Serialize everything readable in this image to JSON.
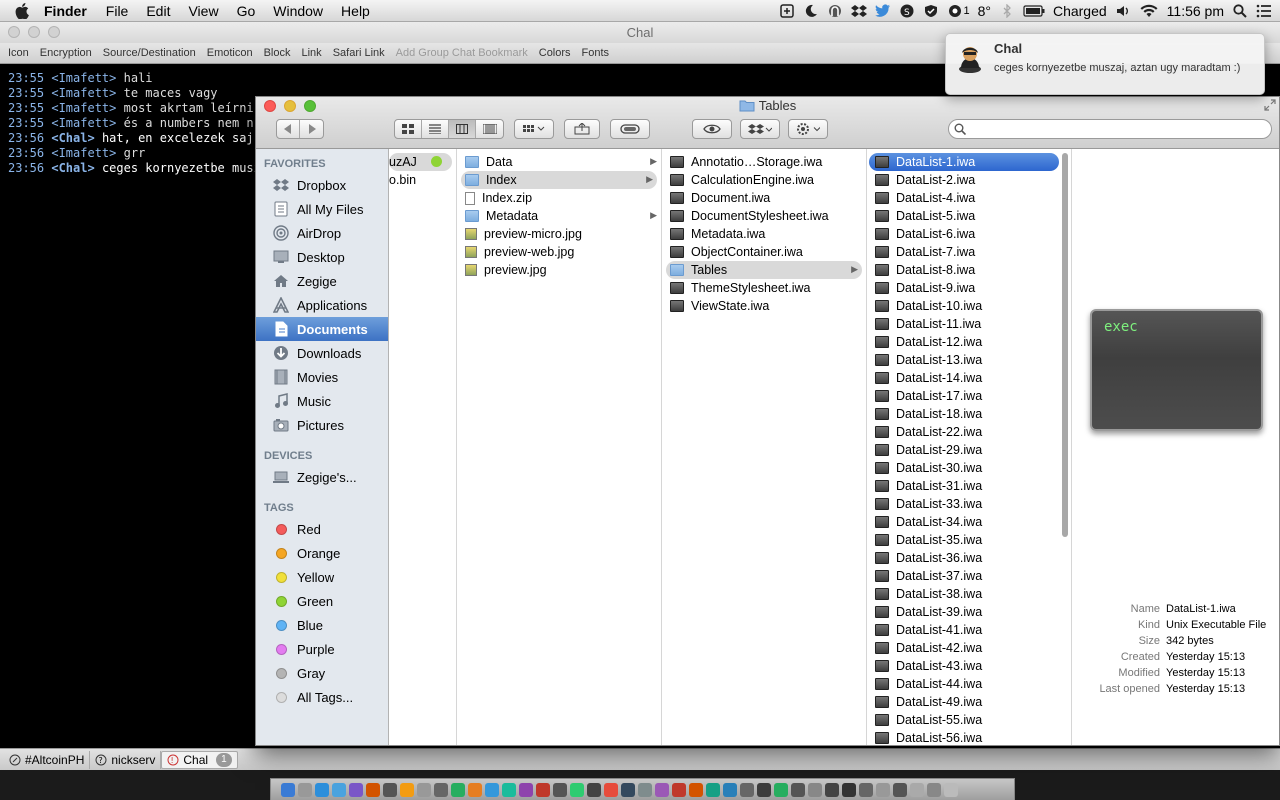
{
  "menubar": {
    "app": "Finder",
    "items": [
      "File",
      "Edit",
      "View",
      "Go",
      "Window",
      "Help"
    ],
    "weather": "8°",
    "notification_count": "1",
    "battery": "Charged",
    "clock": "11:56 pm"
  },
  "chat": {
    "title": "Chal",
    "toolbar": [
      "Icon",
      "Encryption",
      "Source/Destination",
      "Emoticon",
      "Block",
      "Link",
      "Safari Link"
    ],
    "toolbar_disabled": "Add Group Chat Bookmark",
    "toolbar_tail": [
      "Colors",
      "Fonts"
    ],
    "lines": [
      {
        "time": "23:55",
        "nick": "<Imafett>",
        "text": " hali",
        "bright": false
      },
      {
        "time": "23:55",
        "nick": "<Imafett>",
        "text": " te maces vagy",
        "bright": false
      },
      {
        "time": "23:55",
        "nick": "<Imafett>",
        "text": " most akrtam leírni",
        "bright": false
      },
      {
        "time": "23:55",
        "nick": "<Imafett>",
        "text": " és a numbers nem n",
        "bright": false
      },
      {
        "time": "23:56",
        "nick": "<Chal>",
        "text": " hat, en excelezek saj",
        "bright": true
      },
      {
        "time": "23:56",
        "nick": "<Imafett>",
        "text": " grr",
        "bright": false
      },
      {
        "time": "23:56",
        "nick": "<Chal>",
        "text": " ceges kornyezetbe musz",
        "bright": true
      }
    ],
    "tabs": [
      {
        "label": "#AltcoinPH"
      },
      {
        "label": "nickserv"
      },
      {
        "label": "Chal",
        "badge": "1"
      }
    ]
  },
  "notification": {
    "title": "Chal",
    "body": "ceges kornyezetbe muszaj, aztan ugy maradtam :)"
  },
  "finder": {
    "title": "Tables",
    "search_placeholder": "",
    "sidebar": {
      "favorites_header": "FAVORITES",
      "favorites": [
        {
          "label": "Dropbox",
          "icon": "dropbox-icon"
        },
        {
          "label": "All My Files",
          "icon": "all-files-icon"
        },
        {
          "label": "AirDrop",
          "icon": "airdrop-icon"
        },
        {
          "label": "Desktop",
          "icon": "desktop-icon"
        },
        {
          "label": "Zegige",
          "icon": "home-icon"
        },
        {
          "label": "Applications",
          "icon": "applications-icon"
        },
        {
          "label": "Documents",
          "icon": "documents-icon",
          "selected": true
        },
        {
          "label": "Downloads",
          "icon": "downloads-icon"
        },
        {
          "label": "Movies",
          "icon": "movies-icon"
        },
        {
          "label": "Music",
          "icon": "music-icon"
        },
        {
          "label": "Pictures",
          "icon": "pictures-icon"
        }
      ],
      "devices_header": "DEVICES",
      "devices": [
        {
          "label": "Zegige's...",
          "icon": "laptop-icon"
        }
      ],
      "tags_header": "TAGS",
      "tags": [
        {
          "label": "Red",
          "color": "#f45b5b"
        },
        {
          "label": "Orange",
          "color": "#f5a623"
        },
        {
          "label": "Yellow",
          "color": "#f1e03a"
        },
        {
          "label": "Green",
          "color": "#8fd435"
        },
        {
          "label": "Blue",
          "color": "#5fb3f5"
        },
        {
          "label": "Purple",
          "color": "#e37cf0"
        },
        {
          "label": "Gray",
          "color": "#b4b4b4"
        },
        {
          "label": "All Tags...",
          "color": "#dcdcdc"
        }
      ]
    },
    "col1": [
      {
        "label": "uzAJ",
        "tag": "#8fd435"
      },
      {
        "label": "o.bin"
      }
    ],
    "col2": [
      {
        "label": "Data",
        "type": "folder",
        "arrow": true
      },
      {
        "label": "Index",
        "type": "folder",
        "arrow": true,
        "hl": true
      },
      {
        "label": "Index.zip",
        "type": "zip"
      },
      {
        "label": "Metadata",
        "type": "folder",
        "arrow": true
      },
      {
        "label": "preview-micro.jpg",
        "type": "jpg"
      },
      {
        "label": "preview-web.jpg",
        "type": "jpg"
      },
      {
        "label": "preview.jpg",
        "type": "jpg"
      }
    ],
    "col3": [
      {
        "label": "Annotatio…Storage.iwa",
        "type": "iwa"
      },
      {
        "label": "CalculationEngine.iwa",
        "type": "iwa"
      },
      {
        "label": "Document.iwa",
        "type": "iwa"
      },
      {
        "label": "DocumentStylesheet.iwa",
        "type": "iwa"
      },
      {
        "label": "Metadata.iwa",
        "type": "iwa"
      },
      {
        "label": "ObjectContainer.iwa",
        "type": "iwa"
      },
      {
        "label": "Tables",
        "type": "folder",
        "arrow": true,
        "hl": true
      },
      {
        "label": "ThemeStylesheet.iwa",
        "type": "iwa"
      },
      {
        "label": "ViewState.iwa",
        "type": "iwa"
      }
    ],
    "col4": [
      "DataList-1.iwa",
      "DataList-2.iwa",
      "DataList-4.iwa",
      "DataList-5.iwa",
      "DataList-6.iwa",
      "DataList-7.iwa",
      "DataList-8.iwa",
      "DataList-9.iwa",
      "DataList-10.iwa",
      "DataList-11.iwa",
      "DataList-12.iwa",
      "DataList-13.iwa",
      "DataList-14.iwa",
      "DataList-17.iwa",
      "DataList-18.iwa",
      "DataList-22.iwa",
      "DataList-29.iwa",
      "DataList-30.iwa",
      "DataList-31.iwa",
      "DataList-33.iwa",
      "DataList-34.iwa",
      "DataList-35.iwa",
      "DataList-36.iwa",
      "DataList-37.iwa",
      "DataList-38.iwa",
      "DataList-39.iwa",
      "DataList-41.iwa",
      "DataList-42.iwa",
      "DataList-43.iwa",
      "DataList-44.iwa",
      "DataList-49.iwa",
      "DataList-55.iwa",
      "DataList-56.iwa"
    ],
    "col4_selected": "DataList-1.iwa",
    "preview": {
      "icon_text": "exec",
      "info": [
        {
          "k": "Name",
          "v": "DataList-1.iwa"
        },
        {
          "k": "Kind",
          "v": "Unix Executable File"
        },
        {
          "k": "Size",
          "v": "342 bytes"
        },
        {
          "k": "Created",
          "v": "Yesterday 15:13"
        },
        {
          "k": "Modified",
          "v": "Yesterday 15:13"
        },
        {
          "k": "Last opened",
          "v": "Yesterday 15:13"
        }
      ]
    }
  }
}
